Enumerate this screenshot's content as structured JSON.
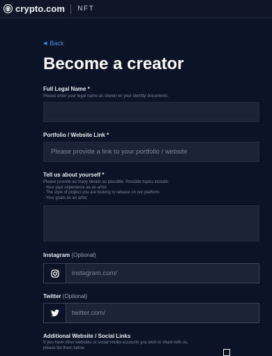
{
  "header": {
    "logo_icon": "crypto-com-lion-logo",
    "brand": "crypto.com",
    "section": "NFT"
  },
  "back": {
    "icon": "chevron-left-icon",
    "label": "Back"
  },
  "page_title": "Become a creator",
  "form": {
    "legal_name": {
      "label": "Full Legal Name *",
      "help": "Please enter your legal name as shown on your identity documents.",
      "value": ""
    },
    "portfolio": {
      "label": "Portfolio / Website Link *",
      "placeholder": "Please provide a link to your portfolio / website"
    },
    "about": {
      "label": "Tell us about yourself *",
      "help_lines": [
        "Please provide as many details as possible. Possible topics include:",
        "- Your past experience as an artist",
        "- The style of project you are looking to release on our platform",
        "- Your goals as an artist"
      ],
      "value": ""
    },
    "instagram": {
      "label": "Instagram",
      "optional": "(Optional)",
      "icon": "instagram-icon",
      "placeholder": "instagram.com/"
    },
    "twitter": {
      "label": "Twitter",
      "optional": "(Optional)",
      "icon": "twitter-icon",
      "placeholder": "twitter.com/"
    },
    "additional": {
      "label": "Additional Website / Social Links",
      "help_lines": [
        "If you have other websites or social media accounts you wish to share with us,",
        "please list them below"
      ]
    }
  },
  "colors": {
    "background": "#0b1426",
    "field": "#1b2336",
    "accent_link": "#3d8fe6"
  }
}
